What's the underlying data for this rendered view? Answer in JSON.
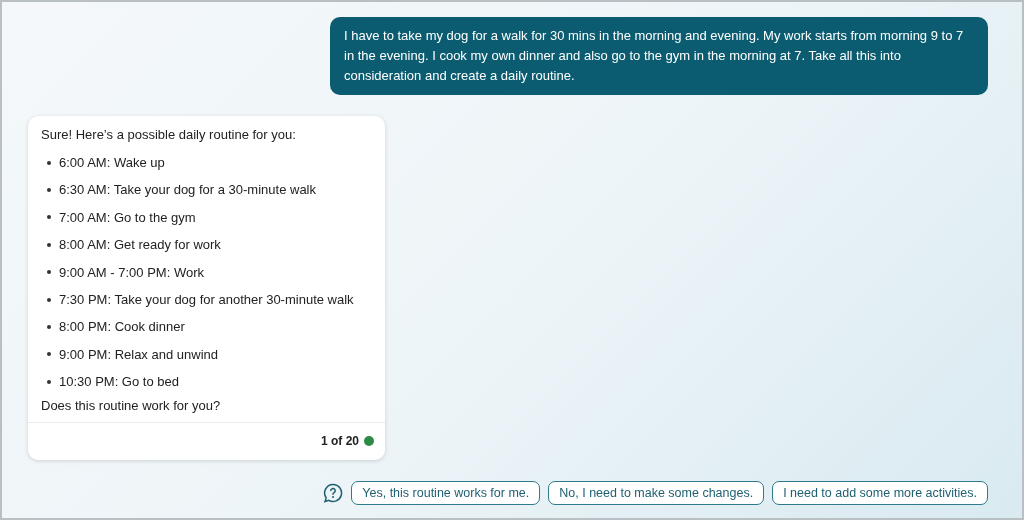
{
  "user_message": "I have to take my dog for a walk for 30 mins in the morning and evening. My work starts from morning 9 to 7 in the evening. I cook my own dinner and also go to the gym in the morning at 7. Take all this into consideration and create a daily routine.",
  "reply": {
    "intro": "Sure! Here’s a possible daily routine for you:",
    "items": [
      "6:00 AM: Wake up",
      "6:30 AM: Take your dog for a 30-minute walk",
      "7:00 AM: Go to the gym",
      "8:00 AM: Get ready for work",
      "9:00 AM - 7:00 PM: Work",
      "7:30 PM: Take your dog for another 30-minute walk",
      "8:00 PM: Cook dinner",
      "9:00 PM: Relax and unwind",
      "10:30 PM: Go to bed"
    ],
    "closing": "Does this routine work for you?",
    "counter": "1 of 20"
  },
  "suggestions": [
    "Yes, this routine works for me.",
    "No, I need to make some changes.",
    "I need to add some more activities."
  ]
}
